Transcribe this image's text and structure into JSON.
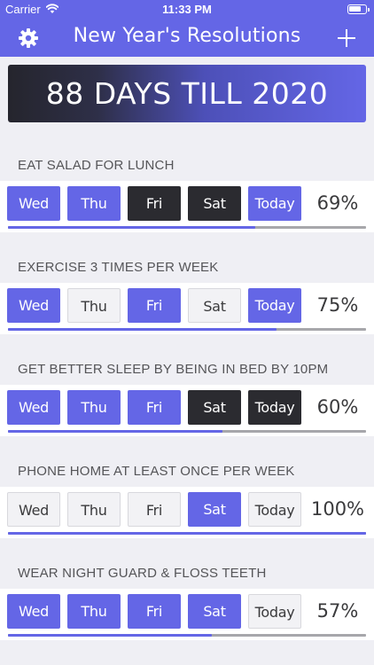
{
  "status_bar": {
    "carrier": "Carrier",
    "time": "11:33 PM"
  },
  "nav": {
    "title": "New Year's Resolutions",
    "left_icon": "gear-icon",
    "right_icon": "plus-icon"
  },
  "countdown": {
    "text": "88 DAYS TILL 2020"
  },
  "colors": {
    "accent": "#6466E6",
    "missed": "#2B2B30",
    "open": "#F2F2F5",
    "background": "#EFEFF4"
  },
  "resolutions": [
    {
      "title": "EAT SALAD FOR LUNCH",
      "percent_label": "69%",
      "progress": 0.69,
      "days": [
        {
          "label": "Wed",
          "state": "done"
        },
        {
          "label": "Thu",
          "state": "done"
        },
        {
          "label": "Fri",
          "state": "missed"
        },
        {
          "label": "Sat",
          "state": "missed"
        },
        {
          "label": "Today",
          "state": "done"
        }
      ]
    },
    {
      "title": "EXERCISE 3 TIMES PER WEEK",
      "percent_label": "75%",
      "progress": 0.75,
      "days": [
        {
          "label": "Wed",
          "state": "done"
        },
        {
          "label": "Thu",
          "state": "open"
        },
        {
          "label": "Fri",
          "state": "done"
        },
        {
          "label": "Sat",
          "state": "open"
        },
        {
          "label": "Today",
          "state": "done"
        }
      ]
    },
    {
      "title": "GET BETTER SLEEP BY BEING IN BED BY 10PM",
      "percent_label": "60%",
      "progress": 0.6,
      "days": [
        {
          "label": "Wed",
          "state": "done"
        },
        {
          "label": "Thu",
          "state": "done"
        },
        {
          "label": "Fri",
          "state": "done"
        },
        {
          "label": "Sat",
          "state": "missed"
        },
        {
          "label": "Today",
          "state": "missed"
        }
      ]
    },
    {
      "title": "PHONE HOME AT LEAST ONCE PER WEEK",
      "percent_label": "100%",
      "progress": 1.0,
      "days": [
        {
          "label": "Wed",
          "state": "open"
        },
        {
          "label": "Thu",
          "state": "open"
        },
        {
          "label": "Fri",
          "state": "open"
        },
        {
          "label": "Sat",
          "state": "done"
        },
        {
          "label": "Today",
          "state": "open"
        }
      ]
    },
    {
      "title": "WEAR NIGHT GUARD & FLOSS TEETH",
      "percent_label": "57%",
      "progress": 0.57,
      "days": [
        {
          "label": "Wed",
          "state": "done"
        },
        {
          "label": "Thu",
          "state": "done"
        },
        {
          "label": "Fri",
          "state": "done"
        },
        {
          "label": "Sat",
          "state": "done"
        },
        {
          "label": "Today",
          "state": "open"
        }
      ]
    }
  ]
}
